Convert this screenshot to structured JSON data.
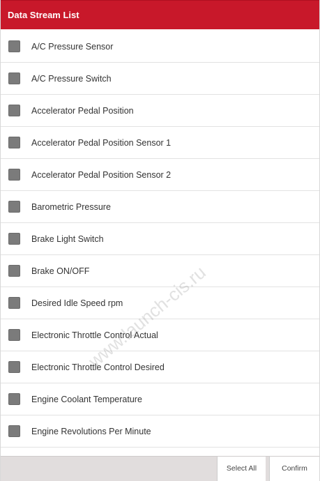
{
  "header": {
    "title": "Data Stream List"
  },
  "list": {
    "items": [
      {
        "label": "A/C Pressure Sensor",
        "checked": false
      },
      {
        "label": "A/C Pressure Switch",
        "checked": false
      },
      {
        "label": "Accelerator Pedal Position",
        "checked": false
      },
      {
        "label": "Accelerator Pedal Position Sensor 1",
        "checked": false
      },
      {
        "label": "Accelerator Pedal Position Sensor 2",
        "checked": false
      },
      {
        "label": "Barometric Pressure",
        "checked": false
      },
      {
        "label": "Brake Light Switch",
        "checked": false
      },
      {
        "label": "Brake ON/OFF",
        "checked": false
      },
      {
        "label": "Desired Idle Speed rpm",
        "checked": false
      },
      {
        "label": "Electronic Throttle Control Actual",
        "checked": false
      },
      {
        "label": "Electronic Throttle Control Desired",
        "checked": false
      },
      {
        "label": "Engine Coolant Temperature",
        "checked": false
      },
      {
        "label": "Engine Revolutions Per Minute",
        "checked": false
      }
    ]
  },
  "footer": {
    "select_all_label": "Select All",
    "confirm_label": "Confirm"
  },
  "watermark": {
    "text": "www.launch-cis.ru"
  },
  "colors": {
    "header_bg": "#c8182a",
    "checkbox_fill": "#7b7b7b",
    "footer_bg": "#e1dddd"
  },
  "icons": {
    "checkbox": "checkbox-unchecked-icon"
  }
}
